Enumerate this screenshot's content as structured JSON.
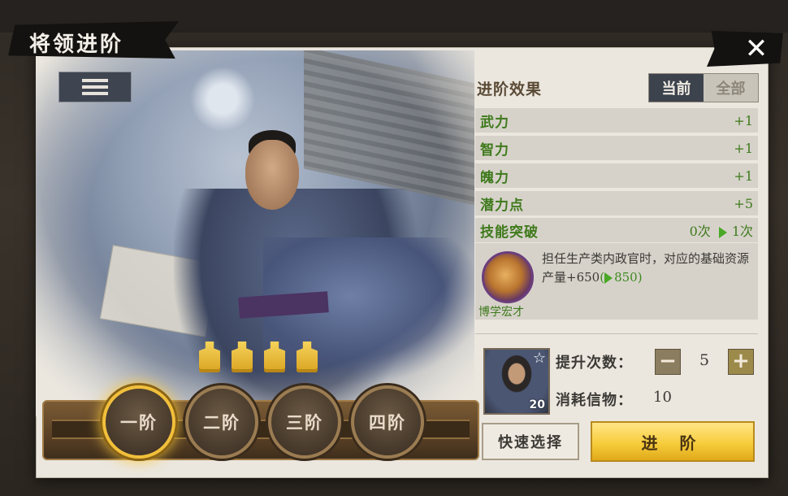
{
  "window": {
    "title": "将领进阶",
    "close_label": "✕"
  },
  "effects": {
    "title": "进阶效果",
    "toggle_current": "当前",
    "toggle_all": "全部",
    "stats": [
      {
        "name": "武力",
        "value": "+1"
      },
      {
        "name": "智力",
        "value": "+1"
      },
      {
        "name": "魄力",
        "value": "+1"
      },
      {
        "name": "潜力点",
        "value": "+5"
      }
    ],
    "skill_break": {
      "name": "技能突破",
      "from": "0次",
      "to": "1次"
    },
    "skill": {
      "name": "博学宏才",
      "desc_main": "担任生产类内政官时，对应的基础资源产量+650",
      "desc_paren_open": "(",
      "desc_next": "850",
      "desc_paren_close": ")"
    }
  },
  "upgrade": {
    "count_label": "提升次数：",
    "count_value": "5",
    "cost_label": "消耗信物：",
    "cost_value": "10",
    "avatar_level": "20",
    "minus": "−",
    "plus": "+"
  },
  "buttons": {
    "quick_select": "快速选择",
    "advance": "进 阶"
  },
  "tiers": [
    "一阶",
    "二阶",
    "三阶",
    "四阶"
  ],
  "active_tier": "一阶",
  "seal_count": 4,
  "colors": {
    "accent_gold": "#f7cd3c",
    "stat_green": "#3f7a1c",
    "arrow_green": "#49a826",
    "toggle_dark": "#3d434d"
  },
  "icons": {
    "close": "close-icon",
    "list": "list-icon",
    "star": "star-icon",
    "seal": "seal-icon",
    "arrow": "arrow-right-icon"
  }
}
